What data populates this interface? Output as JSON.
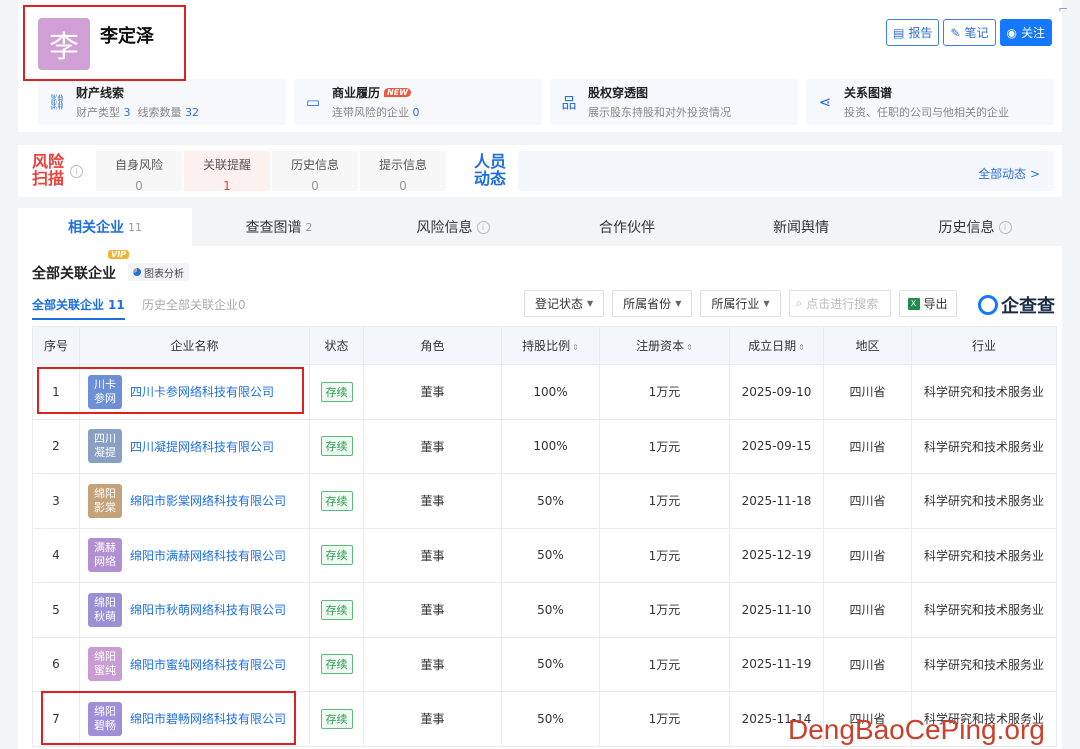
{
  "person": {
    "avatar_char": "李",
    "name": "李定泽"
  },
  "header_buttons": {
    "report": "报告",
    "note": "笔记",
    "follow": "关注"
  },
  "cards": [
    {
      "title": "财产线索",
      "sub_a": "财产类型",
      "sub_a_num": "3",
      "sub_b": "线索数量",
      "sub_b_num": "32"
    },
    {
      "title": "商业履历",
      "badge": "NEW",
      "sub_a": "连带风险的企业",
      "sub_a_num": "0"
    },
    {
      "title": "股权穿透图",
      "sub_a": "展示股东持股和对外投资情况"
    },
    {
      "title": "关系图谱",
      "sub_a": "投资、任职的公司与他相关的企业"
    }
  ],
  "risk": {
    "title": "风险扫描",
    "items": [
      {
        "label": "自身风险",
        "value": "0"
      },
      {
        "label": "关联提醒",
        "value": "1"
      },
      {
        "label": "历史信息",
        "value": "0"
      },
      {
        "label": "提示信息",
        "value": "0"
      }
    ],
    "dynamics_title": "人员动态",
    "more": "全部动态 >"
  },
  "tabs": [
    {
      "label": "相关企业",
      "count": "11"
    },
    {
      "label": "查查图谱",
      "count": "2"
    },
    {
      "label": "风险信息"
    },
    {
      "label": "合作伙伴"
    },
    {
      "label": "新闻舆情"
    },
    {
      "label": "历史信息"
    }
  ],
  "section": {
    "title": "全部关联企业",
    "vip": "VIP",
    "chart_btn": "图表分析",
    "subtab_all": "全部关联企业",
    "subtab_all_count": "11",
    "subtab_history": "历史全部关联企业0"
  },
  "filters": {
    "status": "登记状态",
    "province": "所属省份",
    "industry": "所属行业",
    "search_placeholder": "点击进行搜索",
    "export": "导出"
  },
  "brand": "企查查",
  "table": {
    "headers": [
      "序号",
      "企业名称",
      "状态",
      "角色",
      "持股比例",
      "注册资本",
      "成立日期",
      "地区",
      "行业"
    ],
    "rows": [
      {
        "idx": "1",
        "logo": "川卡参网",
        "logo_color": "#6c8fd8",
        "name": "四川卡参网络科技有限公司",
        "status": "存续",
        "role": "董事",
        "share": "100%",
        "capital": "1万元",
        "date": "2025-09-10",
        "region": "四川省",
        "industry": "科学研究和技术服务业"
      },
      {
        "idx": "2",
        "logo": "四川凝提",
        "logo_color": "#8a9fc4",
        "name": "四川凝提网络科技有限公司",
        "status": "存续",
        "role": "董事",
        "share": "100%",
        "capital": "1万元",
        "date": "2025-09-15",
        "region": "四川省",
        "industry": "科学研究和技术服务业"
      },
      {
        "idx": "3",
        "logo": "绵阳影棠",
        "logo_color": "#c6a27a",
        "name": "绵阳市影棠网络科技有限公司",
        "status": "存续",
        "role": "董事",
        "share": "50%",
        "capital": "1万元",
        "date": "2025-11-18",
        "region": "四川省",
        "industry": "科学研究和技术服务业"
      },
      {
        "idx": "4",
        "logo": "满赫网络",
        "logo_color": "#b28fd0",
        "name": "绵阳市满赫网络科技有限公司",
        "status": "存续",
        "role": "董事",
        "share": "50%",
        "capital": "1万元",
        "date": "2025-12-19",
        "region": "四川省",
        "industry": "科学研究和技术服务业"
      },
      {
        "idx": "5",
        "logo": "绵阳秋萌",
        "logo_color": "#9b8fd6",
        "name": "绵阳市秋萌网络科技有限公司",
        "status": "存续",
        "role": "董事",
        "share": "50%",
        "capital": "1万元",
        "date": "2025-11-10",
        "region": "四川省",
        "industry": "科学研究和技术服务业"
      },
      {
        "idx": "6",
        "logo": "绵阳蜜纯",
        "logo_color": "#c99cd4",
        "name": "绵阳市蜜纯网络科技有限公司",
        "status": "存续",
        "role": "董事",
        "share": "50%",
        "capital": "1万元",
        "date": "2025-11-19",
        "region": "四川省",
        "industry": "科学研究和技术服务业"
      },
      {
        "idx": "7",
        "logo": "绵阳碧畅",
        "logo_color": "#9e8fd8",
        "name": "绵阳市碧畅网络科技有限公司",
        "status": "存续",
        "role": "董事",
        "share": "50%",
        "capital": "1万元",
        "date": "2025-11-14",
        "region": "四川省",
        "industry": "科学研究和技术服务业"
      }
    ]
  },
  "watermark": "DengBaoCePing.org"
}
